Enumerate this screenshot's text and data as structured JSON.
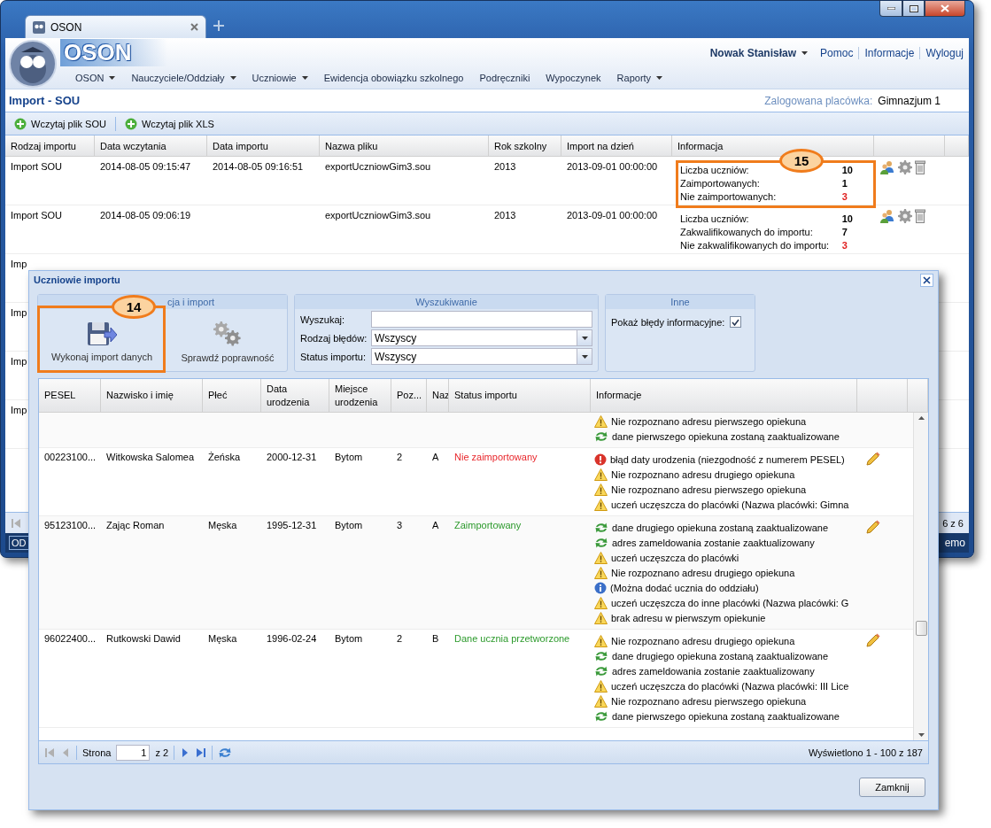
{
  "browser": {
    "tab_title": "OSON"
  },
  "header": {
    "logo": "OSON",
    "user": "Nowak Stanisław",
    "links": [
      "Pomoc",
      "Informacje",
      "Wyloguj"
    ]
  },
  "menu": [
    {
      "label": "OSON",
      "dropdown": true
    },
    {
      "label": "Nauczyciele/Oddziały",
      "dropdown": true
    },
    {
      "label": "Uczniowie",
      "dropdown": true
    },
    {
      "label": "Ewidencja obowiązku szkolnego",
      "dropdown": false
    },
    {
      "label": "Podręczniki",
      "dropdown": false
    },
    {
      "label": "Wypoczynek",
      "dropdown": false
    },
    {
      "label": "Raporty",
      "dropdown": true
    }
  ],
  "page": {
    "title": "Import - SOU",
    "facility_label": "Zalogowana placówka:",
    "facility": "Gimnazjum 1"
  },
  "toolbar": [
    "Wczytaj plik SOU",
    "Wczytaj plik XLS"
  ],
  "imports": {
    "columns": [
      "Rodzaj importu",
      "Data wczytania",
      "Data importu",
      "Nazwa pliku",
      "Rok szkolny",
      "Import na dzień",
      "Informacja"
    ],
    "rows": [
      {
        "type": "Import SOU",
        "loaded": "2014-08-05 09:15:47",
        "imported": "2014-08-05 09:16:51",
        "file": "exportUczniowGim3.sou",
        "year": "2013",
        "as_of": "2013-09-01 00:00:00",
        "info": [
          {
            "label": "Liczba uczniów:",
            "value": "10",
            "alert": false
          },
          {
            "label": "Zaimportowanych:",
            "value": "1",
            "alert": false
          },
          {
            "label": "Nie zaimportowanych:",
            "value": "3",
            "alert": true
          }
        ],
        "actions": true
      },
      {
        "type": "Import SOU",
        "loaded": "2014-08-05 09:06:19",
        "file": "exportUczniowGim3.sou",
        "year": "2013",
        "as_of": "2013-09-01 00:00:00",
        "info": [
          {
            "label": "Liczba uczniów:",
            "value": "10",
            "alert": false
          },
          {
            "label": "Zakwalifikowanych do importu:",
            "value": "7",
            "alert": false
          },
          {
            "label": "Nie zakwalifikowanych do importu:",
            "value": "3",
            "alert": true
          }
        ],
        "actions": true
      },
      {
        "type": "Imp"
      },
      {
        "type": "Imp"
      },
      {
        "type": "Imp"
      },
      {
        "type": "Imp"
      }
    ],
    "pager": "6 z 6"
  },
  "status_bar": {
    "left": "OD",
    "right": "emo"
  },
  "dialog": {
    "title": "Uczniowie importu",
    "actions_group": {
      "legend": "cja i import",
      "buttons": [
        {
          "label": "Wykonaj import danych",
          "kind": "import"
        },
        {
          "label": "Sprawdź poprawność",
          "kind": "validate"
        }
      ]
    },
    "search": {
      "legend": "Wyszukiwanie",
      "fields": [
        {
          "label": "Wyszukaj:",
          "kind": "text"
        },
        {
          "label": "Rodzaj błędów:",
          "kind": "select",
          "value": "Wszyscy"
        },
        {
          "label": "Status importu:",
          "kind": "select",
          "value": "Wszyscy"
        }
      ]
    },
    "other": {
      "legend": "Inne",
      "label": "Pokaż błędy informacyjne:",
      "checked": true
    },
    "grid": {
      "columns": [
        "PESEL",
        "Nazwisko i imię",
        "Płeć",
        "Data urodzenia",
        "Miejsce urodzenia",
        "Poz...",
        "Naz",
        "Status importu",
        "Informacje"
      ],
      "rows": [
        {
          "info": [
            {
              "kind": "warning",
              "text": "Nie rozpoznano adresu pierwszego opiekuna"
            },
            {
              "kind": "sync",
              "text": "dane pierwszego opiekuna zostaną zaaktualizowane"
            }
          ]
        },
        {
          "pesel": "00223100...",
          "name": "Witkowska Salomea",
          "sex": "Żeńska",
          "birth_date": "2000-12-31",
          "birth_place": "Bytom",
          "grade": "2",
          "section": "A",
          "status": "Nie zaimportowany",
          "color": "#e8262b",
          "editable": true,
          "info": [
            {
              "kind": "error",
              "text": "błąd daty urodzenia (niezgodność z numerem PESEL)"
            },
            {
              "kind": "warning",
              "text": "Nie rozpoznano adresu drugiego opiekuna"
            },
            {
              "kind": "warning",
              "text": "Nie rozpoznano adresu pierwszego opiekuna"
            },
            {
              "kind": "warning",
              "text": "uczeń uczęszcza do placówki (Nazwa placówki: Gimna"
            }
          ]
        },
        {
          "pesel": "95123100...",
          "name": "Zając Roman",
          "sex": "Męska",
          "birth_date": "1995-12-31",
          "birth_place": "Bytom",
          "grade": "3",
          "section": "A",
          "status": "Zaimportowany",
          "color": "#2c9a2c",
          "editable": true,
          "info": [
            {
              "kind": "sync",
              "text": "dane drugiego opiekuna zostaną zaaktualizowane"
            },
            {
              "kind": "sync",
              "text": "adres zameldowania zostanie zaaktualizowany"
            },
            {
              "kind": "warning",
              "text": "uczeń uczęszcza do placówki"
            },
            {
              "kind": "warning",
              "text": "Nie rozpoznano adresu drugiego opiekuna"
            },
            {
              "kind": "info",
              "text": "(Można dodać ucznia do oddziału)"
            },
            {
              "kind": "warning",
              "text": "uczeń uczęszcza do inne placówki (Nazwa placówki: G"
            },
            {
              "kind": "warning",
              "text": "brak adresu w pierwszym opiekunie"
            }
          ]
        },
        {
          "pesel": "96022400...",
          "name": "Rutkowski Dawid",
          "sex": "Męska",
          "birth_date": "1996-02-24",
          "birth_place": "Bytom",
          "grade": "2",
          "section": "B",
          "status": "Dane ucznia przetworzone",
          "color": "#2c9a2c",
          "editable": true,
          "info": [
            {
              "kind": "warning",
              "text": "Nie rozpoznano adresu drugiego opiekuna"
            },
            {
              "kind": "sync",
              "text": "dane drugiego opiekuna zostaną zaaktualizowane"
            },
            {
              "kind": "sync",
              "text": "adres zameldowania zostanie zaaktualizowany"
            },
            {
              "kind": "warning",
              "text": "uczeń uczęszcza do placówki (Nazwa placówki: III Lice"
            },
            {
              "kind": "warning",
              "text": "Nie rozpoznano adresu pierwszego opiekuna"
            },
            {
              "kind": "sync",
              "text": "dane pierwszego opiekuna zostaną zaaktualizowane"
            }
          ]
        }
      ]
    },
    "pager": {
      "page_label": "Strona",
      "page": "1",
      "of": "z 2",
      "summary": "Wyświetlono 1 - 100 z 187"
    },
    "close_button": "Zamknij"
  },
  "annotations": [
    {
      "number": "15"
    },
    {
      "number": "14"
    }
  ]
}
